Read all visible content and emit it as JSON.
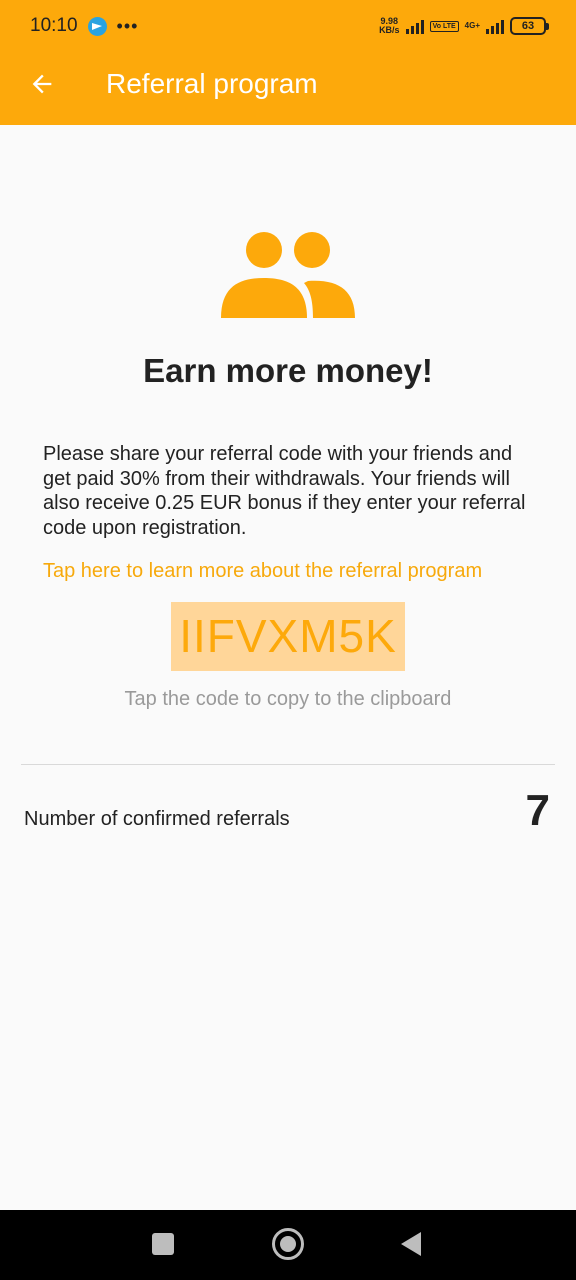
{
  "status_bar": {
    "time": "10:10",
    "dots": "•••",
    "speed_value": "9.98",
    "speed_unit": "KB/s",
    "volte": "Vo LTE",
    "network": "4G+",
    "battery": "63"
  },
  "app_bar": {
    "title": "Referral program"
  },
  "content": {
    "heading": "Earn more money!",
    "description": "Please share your referral code with your friends and get paid 30% from their withdrawals. Your friends will also receive 0.25 EUR bonus if they enter your referral code upon registration.",
    "learn_more": "Tap here to learn more about the referral program",
    "referral_code": "IIFVXM5K",
    "copy_hint": "Tap the code to copy to the clipboard",
    "confirmed_label": "Number of confirmed referrals",
    "confirmed_count": "7"
  },
  "icons": {
    "back": "arrow-left-icon",
    "people": "people-icon",
    "telegram": "telegram-icon"
  },
  "colors": {
    "accent": "#fda90b",
    "code_highlight": "#ffd699",
    "link": "#f7a90c"
  }
}
